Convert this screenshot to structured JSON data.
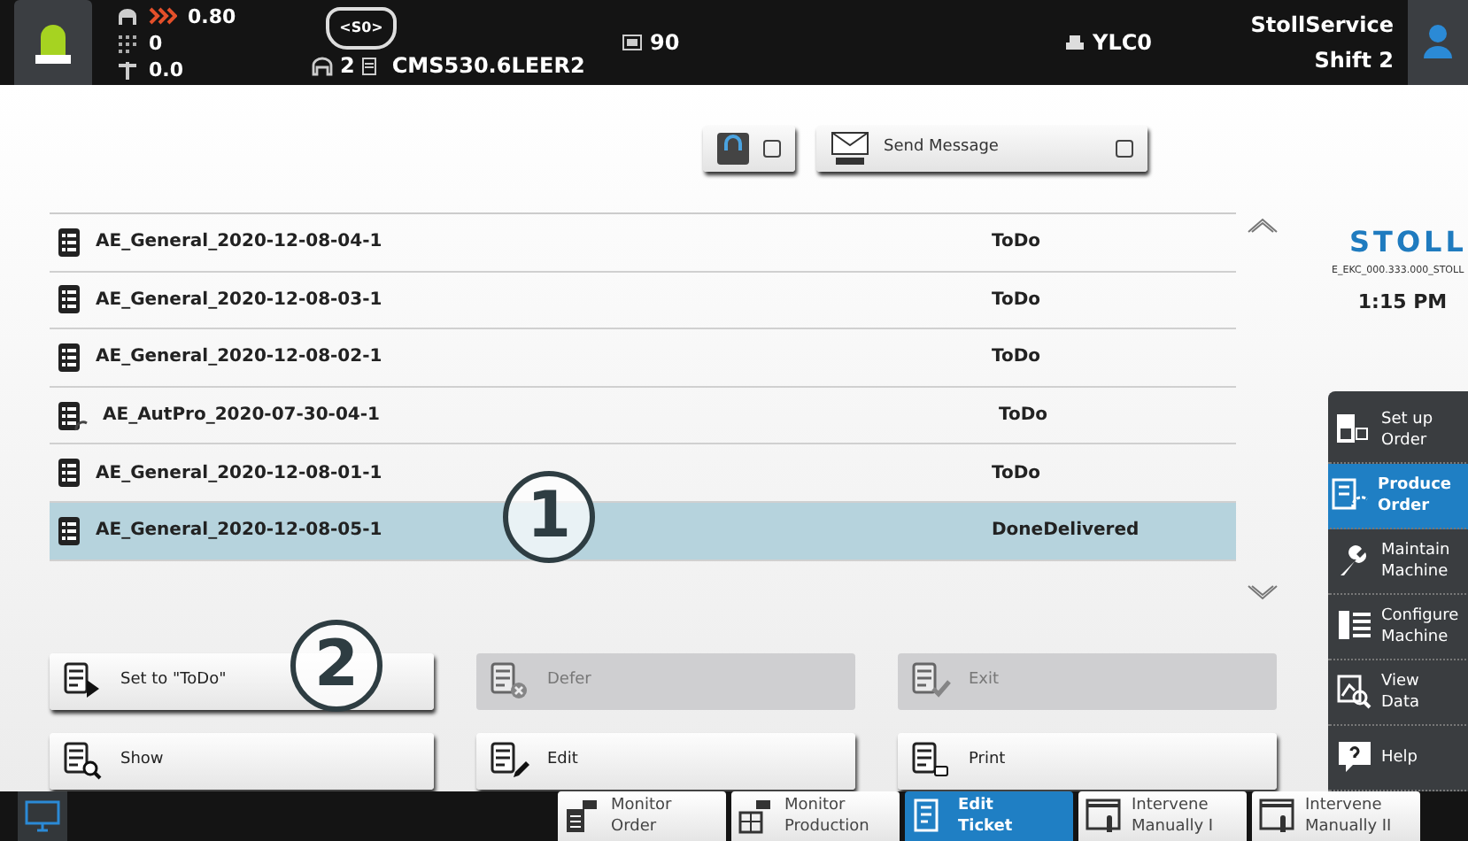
{
  "status_bar": {
    "speed": "0.80",
    "count": "0",
    "tension": "0.0",
    "machine_badge": "<S0>",
    "systems": "2",
    "program": "CMS530.6LEER2",
    "pieces": "90",
    "printer": "YLC0",
    "user": "StollService",
    "shift": "Shift 2"
  },
  "toolbar": {
    "apm": {
      "checked": false
    },
    "send_message": {
      "label": "Send Message",
      "checked": false
    }
  },
  "brand": {
    "logo": "STOLL",
    "version": "E_EKC_000.333.000_STOLL",
    "time": "1:15 PM"
  },
  "tickets": [
    {
      "name": "AE_General_2020-12-08-04-1",
      "status": "ToDo",
      "kind": "general",
      "selected": false
    },
    {
      "name": "AE_General_2020-12-08-03-1",
      "status": "ToDo",
      "kind": "general",
      "selected": false
    },
    {
      "name": "AE_General_2020-12-08-02-1",
      "status": "ToDo",
      "kind": "general",
      "selected": false
    },
    {
      "name": "AE_AutPro_2020-07-30-04-1",
      "status": "ToDo",
      "kind": "autpro",
      "selected": false
    },
    {
      "name": "AE_General_2020-12-08-01-1",
      "status": "ToDo",
      "kind": "general",
      "selected": false
    },
    {
      "name": "AE_General_2020-12-08-05-1",
      "status": "DoneDelivered",
      "kind": "general",
      "selected": true
    }
  ],
  "actions": [
    {
      "label": "Set to \"ToDo\"",
      "kind": "play",
      "disabled": false
    },
    {
      "label": "Defer",
      "kind": "cancel",
      "disabled": true
    },
    {
      "label": "Exit",
      "kind": "check",
      "disabled": true
    },
    {
      "label": "Show",
      "kind": "search",
      "disabled": false
    },
    {
      "label": "Edit",
      "kind": "pencil",
      "disabled": false
    },
    {
      "label": "Print",
      "kind": "print",
      "disabled": false
    }
  ],
  "sidebar": [
    {
      "lines": [
        "Set up",
        "Order"
      ],
      "kind": "setup",
      "selected": false
    },
    {
      "lines": [
        "Produce",
        "Order"
      ],
      "kind": "produce",
      "selected": true
    },
    {
      "lines": [
        "Maintain",
        "Machine"
      ],
      "kind": "wrench",
      "selected": false
    },
    {
      "lines": [
        "Configure",
        "Machine"
      ],
      "kind": "configure",
      "selected": false
    },
    {
      "lines": [
        "View",
        "Data"
      ],
      "kind": "view",
      "selected": false
    },
    {
      "lines": [
        "Help"
      ],
      "kind": "help",
      "selected": false
    }
  ],
  "bottom_tabs": [
    {
      "lines": [
        "Monitor",
        "Order"
      ],
      "kind": "order",
      "selected": false
    },
    {
      "lines": [
        "Monitor",
        "Production"
      ],
      "kind": "production",
      "selected": false
    },
    {
      "lines": [
        "Edit",
        "Ticket"
      ],
      "kind": "ticket",
      "selected": true
    },
    {
      "lines": [
        "Intervene",
        "Manually I"
      ],
      "kind": "hand",
      "selected": false
    },
    {
      "lines": [
        "Intervene",
        "Manually II"
      ],
      "kind": "hand",
      "selected": false
    }
  ],
  "callouts": [
    "1",
    "2"
  ]
}
